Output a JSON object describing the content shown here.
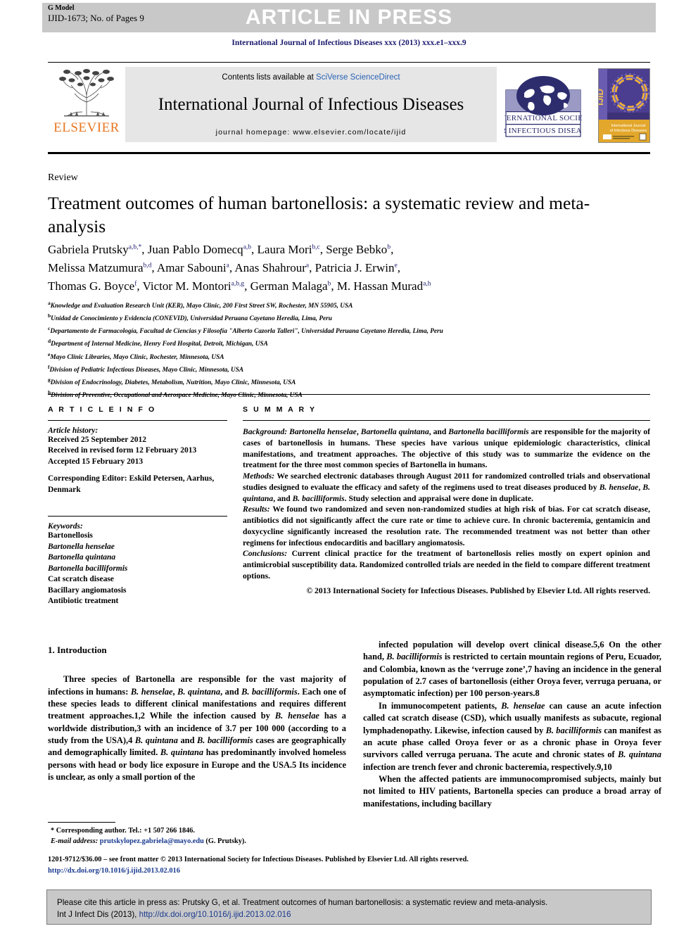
{
  "header": {
    "g_model_label": "G Model",
    "manuscript_id": "IJID-1673; No. of Pages 9",
    "article_in_press": "ARTICLE IN PRESS",
    "journal_citation_line": "International Journal of Infectious Diseases xxx (2013) xxx.e1–xxx.9"
  },
  "masthead": {
    "publisher_name": "ELSEVIER",
    "contents_prefix": "Contents lists available at ",
    "contents_link": "SciVerse ScienceDirect",
    "journal_title": "International Journal of Infectious Diseases",
    "homepage_label": "journal homepage: www.elsevier.com/locate/ijid",
    "society_line1": "INTERNATIONAL SOCIETY",
    "society_line2": "FOR INFECTIOUS DISEASES",
    "cover_spine": "IJID",
    "cover_title_line1": "International Journal",
    "cover_title_line2": "of Infectious Diseases"
  },
  "article": {
    "kind": "Review",
    "title": "Treatment outcomes of human bartonellosis: a systematic review and meta-analysis",
    "authors_lines": [
      "Gabriela Prutsky|a,b,*|, Juan Pablo Domecq|a,b|, Laura Mori|b,c|, Serge Bebko|b|,",
      "Melissa Matzumura|b,d|, Amar Sabouni|a|, Anas Shahrour|a|, Patricia J. Erwin|e|,",
      "Thomas G. Boyce|f|, Victor M. Montori|a,b,g|, German Malaga|b|, M. Hassan Murad|a,h|"
    ],
    "affiliations": [
      {
        "marker": "a",
        "text": "Knowledge and Evaluation Research Unit (KER), Mayo Clinic, 200 First Street SW, Rochester, MN 55905, USA"
      },
      {
        "marker": "b",
        "text": "Unidad de Conocimiento y Evidencia (CONEVID), Universidad Peruana Cayetano Heredia, Lima, Peru"
      },
      {
        "marker": "c",
        "text": "Departamento de Farmacología, Facultad de Ciencias y Filosofía \"Alberto Cazorla Talleri\", Universidad Peruana Cayetano Heredia, Lima, Peru"
      },
      {
        "marker": "d",
        "text": "Department of Internal Medicine, Henry Ford Hospital, Detroit, Michigan, USA"
      },
      {
        "marker": "e",
        "text": "Mayo Clinic Libraries, Mayo Clinic, Rochester, Minnesota, USA"
      },
      {
        "marker": "f",
        "text": "Division of Pediatric Infectious Diseases, Mayo Clinic, Minnesota, USA"
      },
      {
        "marker": "g",
        "text": "Division of Endocrinology, Diabetes, Metabolism, Nutrition, Mayo Clinic, Minnesota, USA"
      },
      {
        "marker": "h",
        "text": "Division of Preventive, Occupational and Aerospace Medicine, Mayo Clinic, Minnesota, USA"
      }
    ]
  },
  "article_info": {
    "section_label": "A R T I C L E   I N F O",
    "history_title": "Article history:",
    "history": [
      "Received 25 September 2012",
      "Received in revised form 12 February 2013",
      "Accepted 15 February 2013"
    ],
    "corresponding_editor_label": "Corresponding Editor:",
    "corresponding_editor_value": " Eskild Petersen, Aarhus, Denmark",
    "keywords_title": "Keywords:",
    "keywords": [
      {
        "text": "Bartonellosis",
        "italic": false
      },
      {
        "text": "Bartonella henselae",
        "italic": true
      },
      {
        "text": "Bartonella quintana",
        "italic": true
      },
      {
        "text": "Bartonella bacilliformis",
        "italic": true
      },
      {
        "text": "Cat scratch disease",
        "italic": false
      },
      {
        "text": "Bacillary angiomatosis",
        "italic": false
      },
      {
        "text": "Antibiotic treatment",
        "italic": false
      }
    ]
  },
  "summary": {
    "section_label": "S U M M A R Y",
    "background_label": "Background:",
    "background_text": " Bartonella henselae, Bartonella quintana, and Bartonella bacilliformis are responsible for the majority of cases of bartonellosis in humans. These species have various unique epidemiologic characteristics, clinical manifestations, and treatment approaches. The objective of this study was to summarize the evidence on the treatment for the three most common species of Bartonella in humans.",
    "methods_label": "Methods:",
    "methods_text": " We searched electronic databases through August 2011 for randomized controlled trials and observational studies designed to evaluate the efficacy and safety of the regimens used to treat diseases produced by B. henselae, B. quintana, and B. bacilliformis. Study selection and appraisal were done in duplicate.",
    "results_label": "Results:",
    "results_text": " We found two randomized and seven non-randomized studies at high risk of bias. For cat scratch disease, antibiotics did not significantly affect the cure rate or time to achieve cure. In chronic bacteremia, gentamicin and doxycycline significantly increased the resolution rate. The recommended treatment was not better than other regimens for infectious endocarditis and bacillary angiomatosis.",
    "conclusions_label": "Conclusions:",
    "conclusions_text": " Current clinical practice for the treatment of bartonellosis relies mostly on expert opinion and antimicrobial susceptibility data. Randomized controlled trials are needed in the field to compare different treatment options.",
    "copyright": "© 2013 International Society for Infectious Diseases. Published by Elsevier Ltd. All rights reserved."
  },
  "body": {
    "intro_heading": "1. Introduction",
    "left_paragraph_1": "Three species of Bartonella are responsible for the vast majority of infections in humans: B. henselae, B. quintana, and B. bacilliformis. Each one of these species leads to different clinical manifestations and requires different treatment approaches.1,2 While the infection caused by B. henselae has a worldwide distribution,3 with an incidence of 3.7 per 100 000 (according to a study from the USA),4 B. quintana and B. bacilliformis cases are geographically and demographically limited. B. quintana has predominantly involved homeless persons with head or body lice exposure in Europe and the USA.5 Its incidence is unclear, as only a small portion of the",
    "right_paragraph_1": "infected population will develop overt clinical disease.5,6 On the other hand, B. bacilliformis is restricted to certain mountain regions of Peru, Ecuador, and Colombia, known as the ‘verruge zone’,7 having an incidence in the general population of 2.7 cases of bartonellosis (either Oroya fever, verruga peruana, or asymptomatic infection) per 100 person-years.8",
    "right_paragraph_2": "In immunocompetent patients, B. henselae can cause an acute infection called cat scratch disease (CSD), which usually manifests as subacute, regional lymphadenopathy. Likewise, infection caused by B. bacilliformis can manifest as an acute phase called Oroya fever or as a chronic phase in Oroya fever survivors called verruga peruana. The acute and chronic states of B. quintana infection are trench fever and chronic bacteremia, respectively.9,10",
    "right_paragraph_3": "When the affected patients are immunocompromised subjects, mainly but not limited to HIV patients, Bartonella species can produce a broad array of manifestations, including bacillary"
  },
  "footnote": {
    "corresponding_author": "Corresponding author. Tel.: +1 507 266 1846.",
    "email_label": "E-mail address:",
    "email": "prutskylopez.gabriela@mayo.edu",
    "email_suffix": " (G. Prutsky).",
    "front_matter": "1201-9712/$36.00 – see front matter © 2013 International Society for Infectious Diseases. Published by Elsevier Ltd. All rights reserved.",
    "doi_url": "http://dx.doi.org/10.1016/j.ijid.2013.02.016"
  },
  "cite_footer": {
    "line1": "Please cite this article in press as: Prutsky G, et al. Treatment outcomes of human bartonellosis: a systematic review and meta-analysis.",
    "line2_prefix": "Int J Infect Dis (2013), ",
    "line2_link": "http://dx.doi.org/10.1016/j.ijid.2013.02.016"
  },
  "colors": {
    "band_grey": "#c8c8c8",
    "link_blue": "#1a3a8f",
    "journal_blue": "#1a1a6e",
    "elsevier_orange": "#E87722",
    "sciencedirect_blue": "#2a63b5",
    "panel_grey": "#e6e6e6"
  }
}
